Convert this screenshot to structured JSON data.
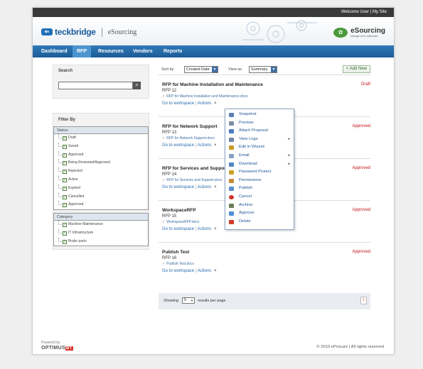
{
  "topbar": {
    "welcome": "Welcome User",
    "separator": "|",
    "mysite": "My Site"
  },
  "header": {
    "logo_mark": "⇐",
    "logo_text": "teckbridge",
    "app_name": "eSourcing",
    "brand2_name": "eSourcing",
    "brand2_tagline": "Manage and Collaborate"
  },
  "nav": {
    "items": [
      "Dashboard",
      "RFP",
      "Resources",
      "Vendors",
      "Reports"
    ],
    "active": "RFP"
  },
  "sidebar": {
    "search_heading": "Search",
    "search_value": "",
    "filter_heading": "Filter By",
    "status_heading": "Status",
    "status_options": [
      "Draft",
      "Saved",
      "Approved",
      "Being Reviewed/Approved",
      "Rejected",
      "Active",
      "Expired",
      "Cancelled",
      "Approved"
    ],
    "category_heading": "Category",
    "category_options": [
      "Machine Maintenance",
      "IT Infrastructure",
      "Brake parts"
    ]
  },
  "toolbar": {
    "sort_label": "Sort by",
    "sort_value": "Created Date",
    "view_label": "View as",
    "view_value": "Summary",
    "add_button": "Add New"
  },
  "rfps": [
    {
      "title": "RFP for Machine Installation and Maintenance",
      "number": "RFP 12",
      "file": "RFP for Machine Installation and Maintenance.docx",
      "status": "Draft"
    },
    {
      "title": "RFP for Network Support",
      "number": "RFP 13",
      "file": "RFP for Network Support.docx",
      "status": "Approved"
    },
    {
      "title": "RFP for Services and Support",
      "number": "RFP 14",
      "file": "RFP for Services and Support.docx",
      "status": "Approved"
    },
    {
      "title": "WorkspaceRFP",
      "number": "RFP 15",
      "file": "WorkspaceRFP.docx",
      "status": "Approved"
    },
    {
      "title": "Publish Test",
      "number": "RFP 16",
      "file": "Publish Test.docx",
      "status": "Approved"
    }
  ],
  "row_links": {
    "workspace": "Go to workspace",
    "separator": "|",
    "actions": "Actions",
    "close": "×"
  },
  "actions_menu": {
    "items": [
      {
        "label": "Snapshot",
        "icon": "snapshot-icon",
        "color": "#5b7fb5",
        "submenu": false
      },
      {
        "label": "Preview",
        "icon": "preview-icon",
        "color": "#7c8fa6",
        "submenu": false
      },
      {
        "label": "Attach Proposal",
        "icon": "attach-icon",
        "color": "#4a7bbf",
        "submenu": false
      },
      {
        "label": "View Logs",
        "icon": "logs-icon",
        "color": "#6f86a8",
        "submenu": true
      },
      {
        "label": "Edit in Wizard",
        "icon": "wizard-icon",
        "color": "#c79b2a",
        "submenu": false
      },
      {
        "label": "Email",
        "icon": "email-icon",
        "color": "#8aa0c0",
        "submenu": true
      },
      {
        "label": "Download",
        "icon": "download-icon",
        "color": "#4f86c6",
        "submenu": true
      },
      {
        "label": "Password Protect",
        "icon": "lock-icon",
        "color": "#d0a02a",
        "submenu": false
      },
      {
        "label": "Permissions",
        "icon": "permissions-icon",
        "color": "#c98a3a",
        "submenu": false
      },
      {
        "label": "Publish",
        "icon": "publish-icon",
        "color": "#5a8fd0",
        "submenu": false
      },
      {
        "label": "Cancel",
        "icon": "cancel-icon",
        "color": "#d0302a",
        "submenu": false
      },
      {
        "label": "Archive",
        "icon": "archive-icon",
        "color": "#6b7c57",
        "submenu": false
      },
      {
        "label": "Approve",
        "icon": "approve-icon",
        "color": "#4a8fd8",
        "submenu": false
      },
      {
        "label": "Delete",
        "icon": "delete-icon",
        "color": "#d23b2a",
        "submenu": false
      }
    ]
  },
  "pagination": {
    "showing_label": "Showing",
    "per_page_value": "5",
    "per_page_label": "results per page",
    "page_number": "1"
  },
  "footer": {
    "powered_by": "Powered by",
    "optimus_text": "OPTIMUS",
    "optimus_badge": "BT",
    "copyright": "© 2010 eProcure | All rights reserved"
  }
}
